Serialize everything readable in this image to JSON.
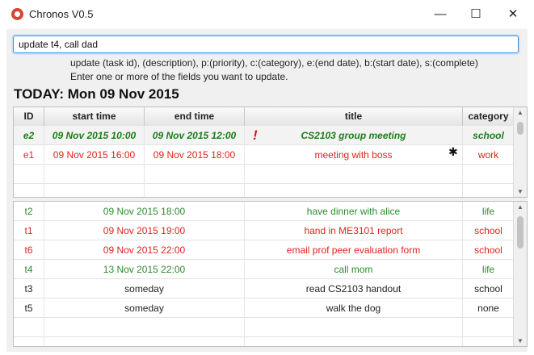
{
  "window": {
    "title": "Chronos V0.5",
    "controls": {
      "minimize": "—",
      "maximize": "☐",
      "close": "✕"
    }
  },
  "command": {
    "value": "update t4, call dad"
  },
  "help": {
    "line1": "update (task id), (description), p:(priority), c:(category), e:(end date), b:(start date), s:(complete)",
    "line2": "Enter one or more of the fields you want to update."
  },
  "today_label": "TODAY: Mon 09 Nov 2015",
  "events_table": {
    "headers": [
      "ID",
      "start time",
      "end time",
      "title",
      "category"
    ],
    "rows": [
      {
        "id": "e2",
        "start": "09 Nov 2015 10:00",
        "end": "09 Nov 2015 12:00",
        "title": "CS2103 group meeting",
        "category": "school",
        "color": "#1a7f1a",
        "style": "bold-italic",
        "priority_mark": "!"
      },
      {
        "id": "e1",
        "start": "09 Nov 2015 16:00",
        "end": "09 Nov 2015 18:00",
        "title": "meeting with boss",
        "category": "work",
        "color": "#e0231f",
        "style": "normal",
        "mark": "✱"
      }
    ]
  },
  "tasks_table": {
    "rows": [
      {
        "id": "t2",
        "due": "09 Nov 2015 18:00",
        "title": "have dinner with alice",
        "category": "life",
        "color": "#2e8b2e"
      },
      {
        "id": "t1",
        "due": "09 Nov 2015 19:00",
        "title": "hand in ME3101 report",
        "category": "school",
        "color": "#e0231f"
      },
      {
        "id": "t6",
        "due": "09 Nov 2015 22:00",
        "title": "email prof peer evaluation form",
        "category": "school",
        "color": "#e0231f"
      },
      {
        "id": "t4",
        "due": "13 Nov 2015 22:00",
        "title": "call mom",
        "category": "life",
        "color": "#2e8b2e"
      },
      {
        "id": "t3",
        "due": "someday",
        "title": "read CS2103 handout",
        "category": "school",
        "color": "#222222"
      },
      {
        "id": "t5",
        "due": "someday",
        "title": "walk the dog",
        "category": "none",
        "color": "#222222"
      }
    ]
  }
}
